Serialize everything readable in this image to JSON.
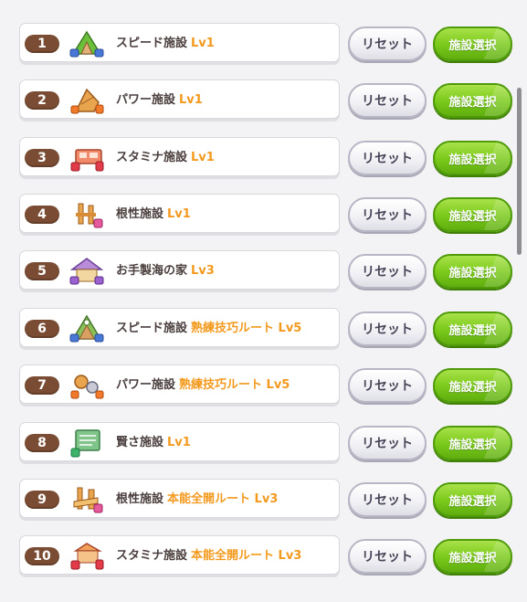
{
  "facilities": [
    {
      "num": "1",
      "name": "スピード施設",
      "lv": "Lv1",
      "icon": "speed-facility-icon"
    },
    {
      "num": "2",
      "name": "パワー施設",
      "lv": "Lv1",
      "icon": "power-facility-icon"
    },
    {
      "num": "3",
      "name": "スタミナ施設",
      "lv": "Lv1",
      "icon": "stamina-facility-icon"
    },
    {
      "num": "4",
      "name": "根性施設",
      "lv": "Lv1",
      "icon": "guts-facility-icon"
    },
    {
      "num": "5",
      "name": "お手製海の家",
      "lv": "Lv3",
      "icon": "beach-house-icon"
    },
    {
      "num": "6",
      "name": "スピード施設",
      "lv": "熟練技巧ルート Lv5",
      "icon": "speed-facility-icon"
    },
    {
      "num": "7",
      "name": "パワー施設",
      "lv": "熟練技巧ルート Lv5",
      "icon": "power-facility-icon"
    },
    {
      "num": "8",
      "name": "賢さ施設",
      "lv": "Lv1",
      "icon": "wisdom-facility-icon"
    },
    {
      "num": "9",
      "name": "根性施設",
      "lv": "本能全開ルート Lv3",
      "icon": "guts-facility-icon"
    },
    {
      "num": "10",
      "name": "スタミナ施設",
      "lv": "本能全開ルート Lv3",
      "icon": "stamina-facility-icon"
    }
  ],
  "buttons": {
    "reset_label": "リセット",
    "select_label": "施設選択"
  },
  "colors": {
    "badge": "#7a4c33",
    "level_text": "#f39a1e",
    "select_button": "#7ccb1c",
    "reset_button_border": "#b8b6c4"
  }
}
